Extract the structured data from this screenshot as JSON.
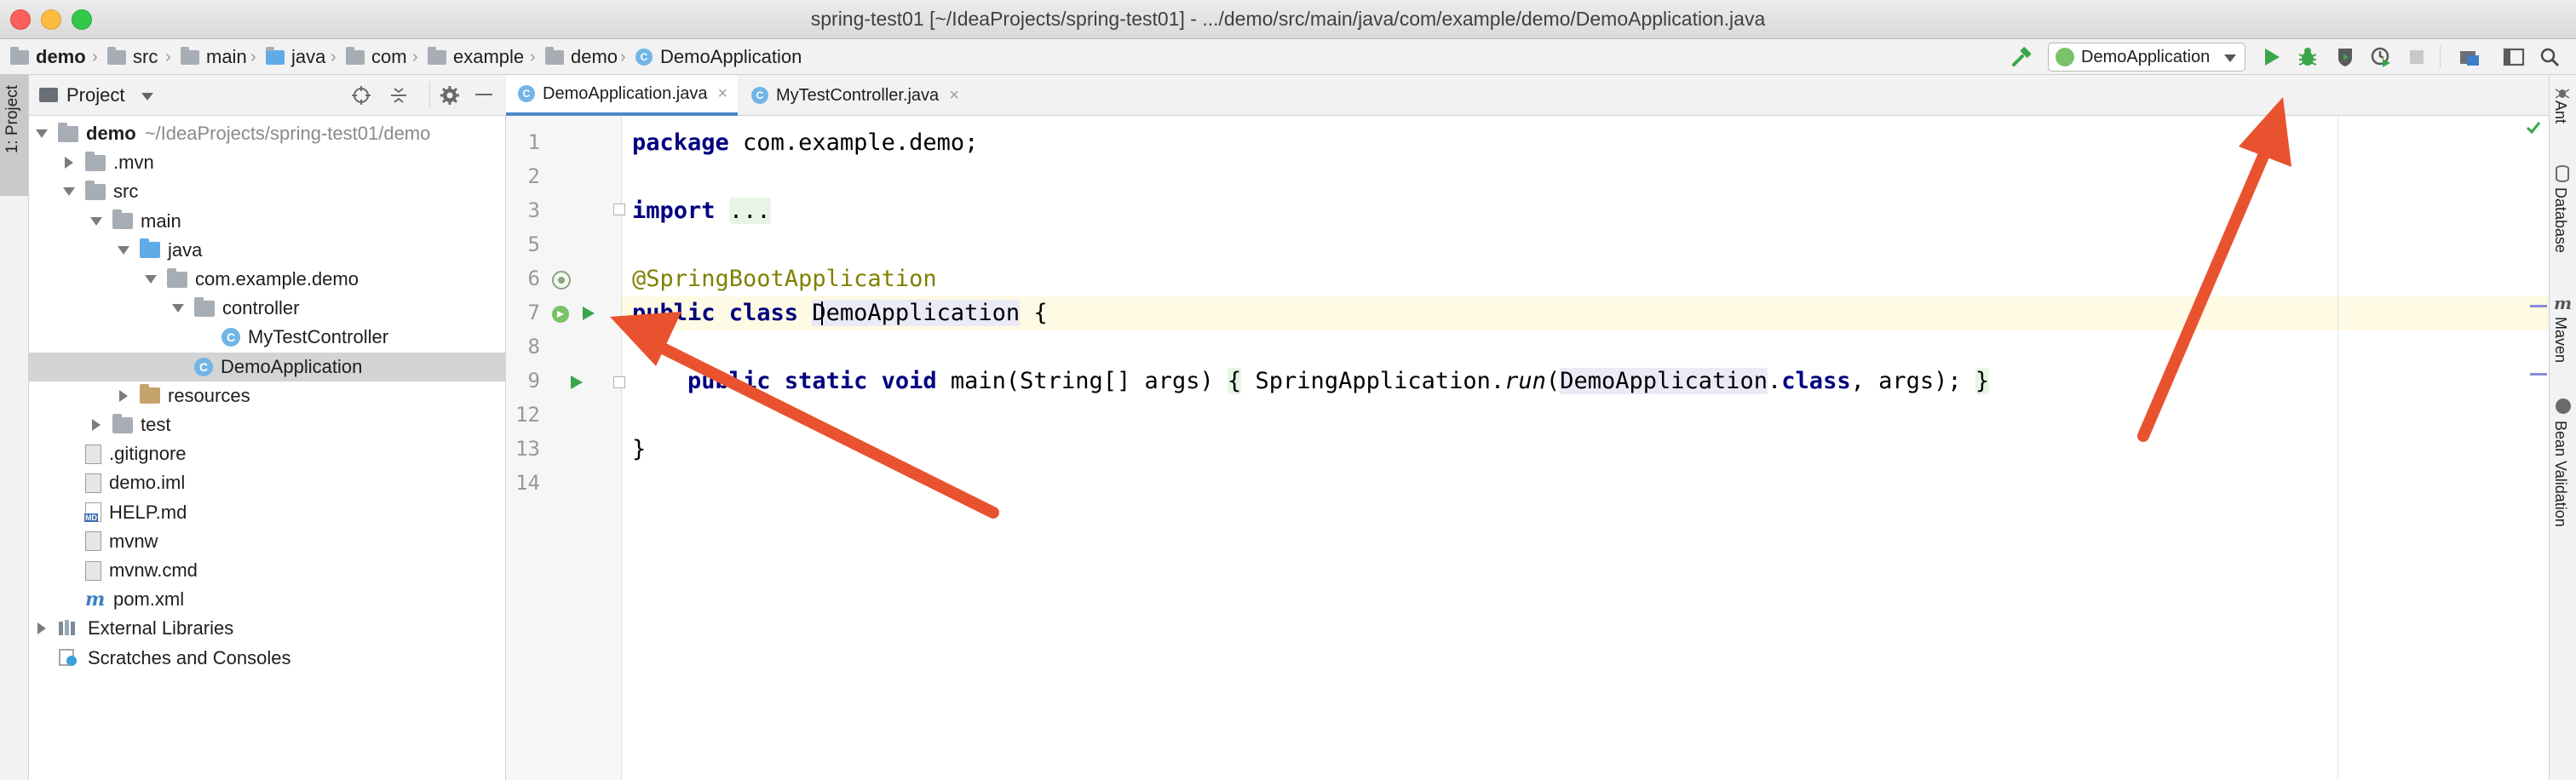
{
  "window": {
    "title": "spring-test01 [~/IdeaProjects/spring-test01] - .../demo/src/main/java/com/example/demo/DemoApplication.java"
  },
  "breadcrumbs": [
    "demo",
    "src",
    "main",
    "java",
    "com",
    "example",
    "demo",
    "DemoApplication"
  ],
  "toolbar": {
    "run_config": "DemoApplication",
    "icons": [
      "hammer-icon",
      "run-icon",
      "debug-icon",
      "coverage-icon",
      "profile-icon",
      "stop-icon",
      "project-structure-icon",
      "terminal-icon",
      "search-icon"
    ],
    "run_color": "#3aa64a"
  },
  "left_strip": {
    "project_tab": "1: Project"
  },
  "project_panel": {
    "title": "Project",
    "tree": [
      {
        "label": "demo",
        "extra": "~/IdeaProjects/spring-test01/demo",
        "depth": 0,
        "arrow": "down",
        "icon": "module-folder",
        "bold": true
      },
      {
        "label": ".mvn",
        "depth": 1,
        "arrow": "right",
        "icon": "folder"
      },
      {
        "label": "src",
        "depth": 1,
        "arrow": "down",
        "icon": "folder"
      },
      {
        "label": "main",
        "depth": 2,
        "arrow": "down",
        "icon": "folder"
      },
      {
        "label": "java",
        "depth": 3,
        "arrow": "down",
        "icon": "source-folder"
      },
      {
        "label": "com.example.demo",
        "depth": 4,
        "arrow": "down",
        "icon": "package"
      },
      {
        "label": "controller",
        "depth": 5,
        "arrow": "down",
        "icon": "package"
      },
      {
        "label": "MyTestController",
        "depth": 6,
        "arrow": "none",
        "icon": "class"
      },
      {
        "label": "DemoApplication",
        "depth": 5,
        "arrow": "none",
        "icon": "spring-class",
        "selected": true
      },
      {
        "label": "resources",
        "depth": 3,
        "arrow": "right",
        "icon": "resources-folder"
      },
      {
        "label": "test",
        "depth": 2,
        "arrow": "right",
        "icon": "folder"
      },
      {
        "label": ".gitignore",
        "depth": 1,
        "arrow": "none",
        "icon": "file"
      },
      {
        "label": "demo.iml",
        "depth": 1,
        "arrow": "none",
        "icon": "file"
      },
      {
        "label": "HELP.md",
        "depth": 1,
        "arrow": "none",
        "icon": "markdown"
      },
      {
        "label": "mvnw",
        "depth": 1,
        "arrow": "none",
        "icon": "file"
      },
      {
        "label": "mvnw.cmd",
        "depth": 1,
        "arrow": "none",
        "icon": "file"
      },
      {
        "label": "pom.xml",
        "depth": 1,
        "arrow": "none",
        "icon": "maven"
      },
      {
        "label": "External Libraries",
        "depth": 0,
        "arrow": "right",
        "icon": "library"
      },
      {
        "label": "Scratches and Consoles",
        "depth": 0,
        "arrow": "none",
        "icon": "scratches"
      }
    ]
  },
  "editor": {
    "tabs": [
      {
        "label": "DemoApplication.java",
        "active": true
      },
      {
        "label": "MyTestController.java",
        "active": false
      }
    ],
    "close_glyph": "×",
    "line_numbers": [
      "1",
      "2",
      "3",
      "5",
      "6",
      "7",
      "8",
      "9",
      "12",
      "13",
      "14"
    ],
    "code": {
      "l1_kw": "package",
      "l1_rest": " com.example.demo;",
      "l3_kw": "import",
      "l3_fold": "...",
      "l6_ann": "@SpringBootApplication",
      "l7_kw": "public class",
      "l7_name": "DemoApplication",
      "l7_rest": " {",
      "l9_kw": "public static void",
      "l9_a": " main(String[] args) ",
      "l9_open": "{",
      "l9_b": " SpringApplication.",
      "l9_run": "run",
      "l9_c": "(",
      "l9_cls": "DemoApplication",
      "l9_d": ".",
      "l9_kw2": "class",
      "l9_e": ", args); ",
      "l9_close": "}",
      "l13": "}"
    }
  },
  "right_strip": {
    "tabs": [
      "Ant",
      "Database",
      "Maven",
      "Bean Validation"
    ]
  },
  "annotations": {
    "arrow_color": "#e8522e"
  }
}
